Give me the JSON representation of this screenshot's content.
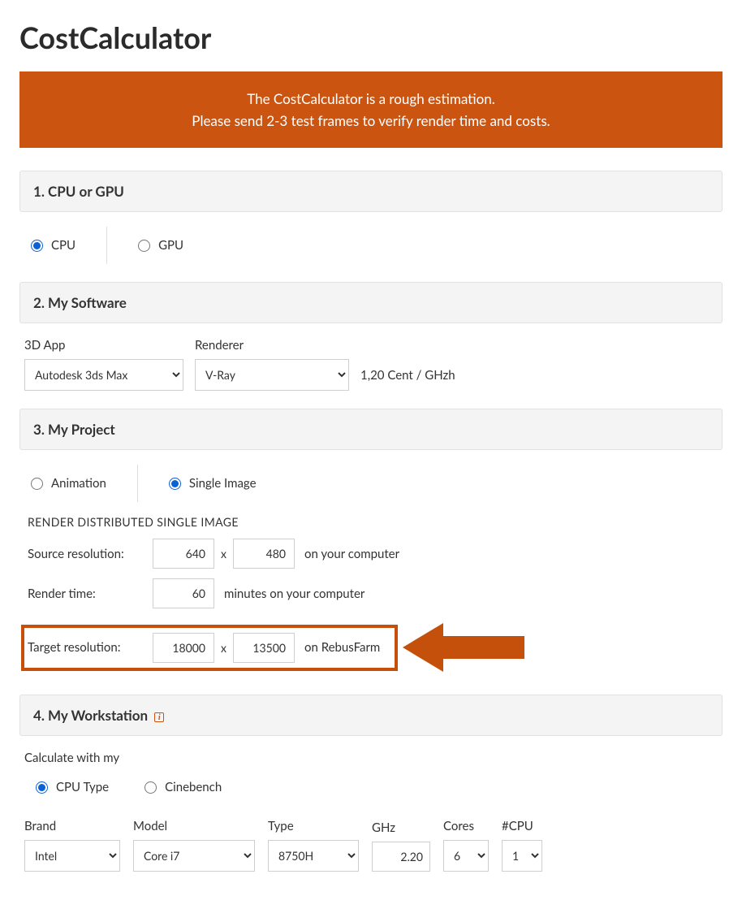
{
  "title": "CostCalculator",
  "alert": {
    "line1": "The CostCalculator is a rough estimation.",
    "line2": "Please send 2-3 test frames to verify render time and costs."
  },
  "section1": {
    "heading": "1. CPU or GPU",
    "cpu": "CPU",
    "gpu": "GPU"
  },
  "section2": {
    "heading": "2. My Software",
    "app_label": "3D App",
    "app_value": "Autodesk 3ds Max",
    "renderer_label": "Renderer",
    "renderer_value": "V-Ray",
    "price": "1,20 Cent / GHzh"
  },
  "section3": {
    "heading": "3. My Project",
    "animation": "Animation",
    "single": "Single Image",
    "subheading": "RENDER DISTRIBUTED SINGLE IMAGE",
    "src_label": "Source resolution:",
    "src_w": "640",
    "src_h": "480",
    "src_suffix": "on your computer",
    "rt_label": "Render time:",
    "rt_val": "60",
    "rt_suffix": "minutes on your computer",
    "tgt_label": "Target resolution:",
    "tgt_w": "18000",
    "tgt_h": "13500",
    "tgt_suffix": "on RebusFarm",
    "x": "x"
  },
  "section4": {
    "heading": "4. My Workstation",
    "calc_label": "Calculate with my",
    "cputype": "CPU Type",
    "cinebench": "Cinebench",
    "brand_label": "Brand",
    "brand_val": "Intel",
    "model_label": "Model",
    "model_val": "Core i7",
    "type_label": "Type",
    "type_val": "8750H",
    "ghz_label": "GHz",
    "ghz_val": "2.20",
    "cores_label": "Cores",
    "cores_val": "6",
    "ncpu_label": "#CPU",
    "ncpu_val": "1"
  }
}
